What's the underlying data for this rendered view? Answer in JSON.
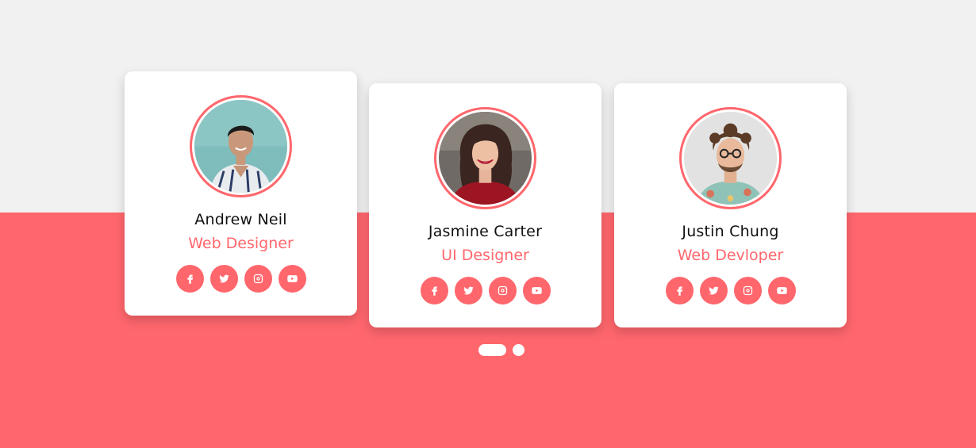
{
  "colors": {
    "accent": "#ff676d",
    "background_top": "#f1f1f1",
    "card": "#ffffff"
  },
  "cards": [
    {
      "name": "Andrew Neil",
      "role": "Web Designer",
      "avatar_icon": "man-portrait-photo",
      "socials": [
        "facebook-icon",
        "twitter-icon",
        "instagram-icon",
        "youtube-icon"
      ]
    },
    {
      "name": "Jasmine Carter",
      "role": "UI Designer",
      "avatar_icon": "woman-portrait-photo",
      "socials": [
        "facebook-icon",
        "twitter-icon",
        "instagram-icon",
        "youtube-icon"
      ]
    },
    {
      "name": "Justin Chung",
      "role": "Web Devloper",
      "avatar_icon": "curly-hair-man-portrait-photo",
      "socials": [
        "facebook-icon",
        "twitter-icon",
        "instagram-icon",
        "youtube-icon"
      ]
    }
  ],
  "pagination": {
    "count": 2,
    "active_index": 0
  }
}
